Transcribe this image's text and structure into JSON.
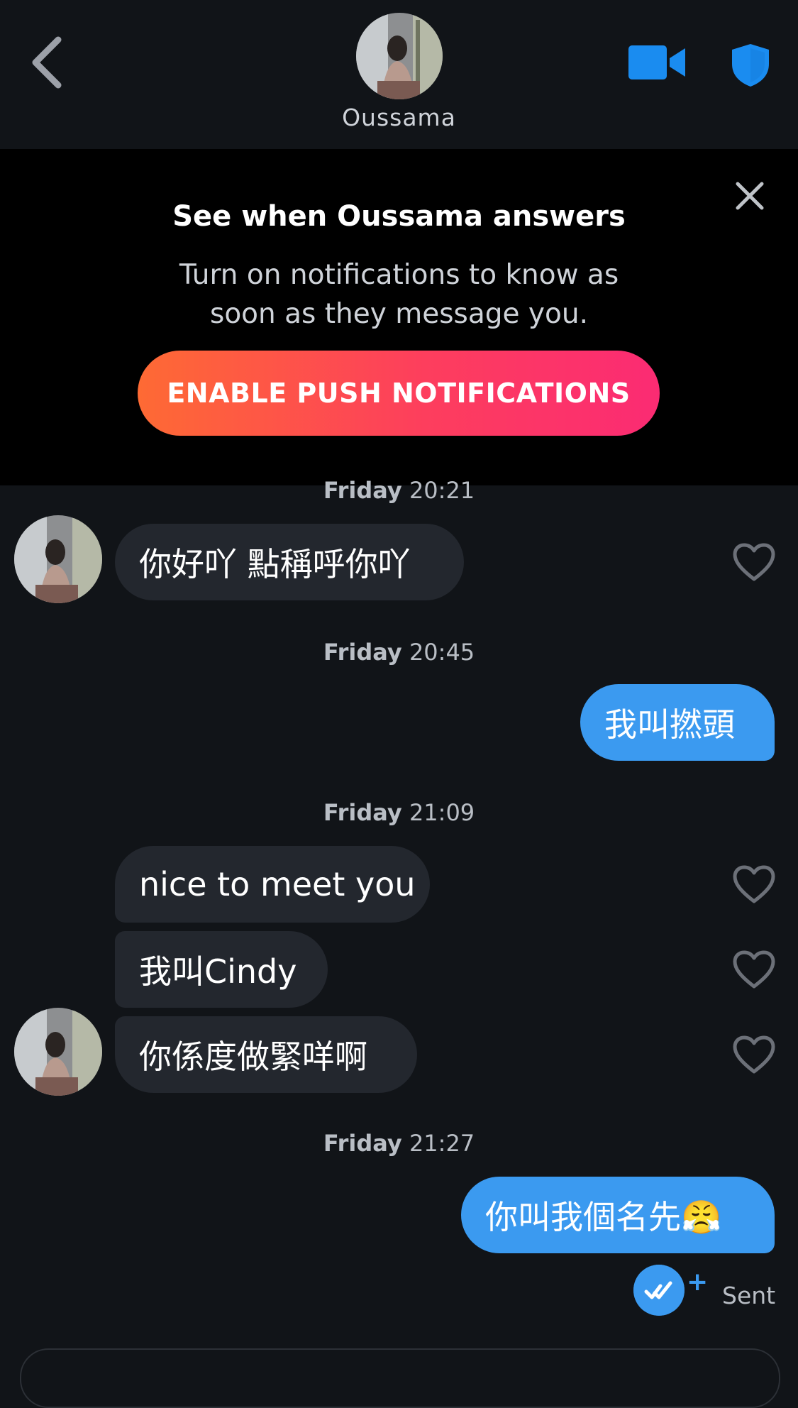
{
  "header": {
    "contact_name": "Oussama",
    "icons": [
      "back-chevron-icon",
      "video-call-icon",
      "safety-shield-icon"
    ]
  },
  "banner": {
    "title": "See when Oussama answers",
    "text_line1": "Turn on notifications to know as",
    "text_line2": "soon as they message you.",
    "button_label": "ENABLE PUSH NOTIFICATIONS",
    "colors": {
      "gradient_start": "#fe6a34",
      "gradient_end": "#fb2b73"
    }
  },
  "messages": {
    "ts1": {
      "day": "Friday",
      "time": "20:21"
    },
    "m1": "你好吖 點稱呼你吖",
    "ts2": {
      "day": "Friday",
      "time": "20:45"
    },
    "m2": "我叫撚頭",
    "ts3": {
      "day": "Friday",
      "time": "21:09"
    },
    "m3": "nice to meet you",
    "m4": "我叫Cindy",
    "m5": "你係度做緊咩啊",
    "ts4": {
      "day": "Friday",
      "time": "21:27"
    },
    "m6": "你叫我個名先😤",
    "status": "Sent",
    "plus": "+"
  },
  "colors": {
    "background": "#111418",
    "outgoing_bubble": "#3b9af0",
    "incoming_bubble": "#23272e",
    "accent": "#1a8cf0"
  }
}
